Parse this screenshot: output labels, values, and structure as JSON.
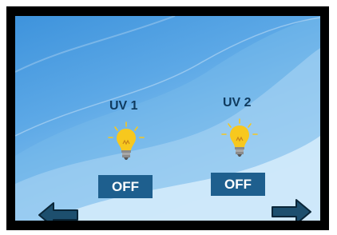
{
  "channels": [
    {
      "label": "UV 1",
      "state": "OFF",
      "icon": "lightbulb-icon"
    },
    {
      "label": "UV 2",
      "state": "OFF",
      "icon": "lightbulb-icon"
    }
  ],
  "navigation": {
    "back_icon": "arrow-left-icon",
    "forward_icon": "arrow-right-icon"
  },
  "colors": {
    "button_bg": "#1e5f8e",
    "button_text": "#ffffff",
    "label_text": "#0f3a5e",
    "bulb_yellow": "#f7c81e"
  }
}
